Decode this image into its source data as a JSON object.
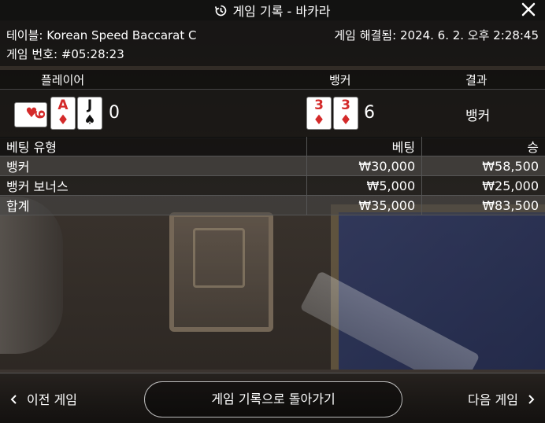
{
  "header": {
    "title": "게임 기록 - 바카라",
    "close_icon": "close-icon",
    "history_icon": "history-icon"
  },
  "meta": {
    "table_label": "테이블:",
    "table_name": "Korean Speed Baccarat C",
    "game_no_label": "게임 번호:",
    "game_no": "#05:28:23",
    "resolved_label": "게임 해결됨:",
    "resolved_time": "2024. 6. 2. 오후 2:28:45"
  },
  "outcome": {
    "player_header": "플레이어",
    "banker_header": "뱅커",
    "result_header": "결과",
    "player_cards": [
      {
        "rank": "9",
        "suit": "♥",
        "color": "#d42a2a",
        "sideways": true
      },
      {
        "rank": "A",
        "suit": "♦",
        "color": "#d42a2a",
        "sideways": false
      },
      {
        "rank": "J",
        "suit": "♠",
        "color": "#111111",
        "sideways": false
      }
    ],
    "player_score": "0",
    "banker_cards": [
      {
        "rank": "3",
        "suit": "♦",
        "color": "#d42a2a",
        "sideways": false
      },
      {
        "rank": "3",
        "suit": "♦",
        "color": "#d42a2a",
        "sideways": false
      }
    ],
    "banker_score": "6",
    "result": "뱅커"
  },
  "bets": {
    "headers": [
      "베팅 유형",
      "베팅",
      "승"
    ],
    "rows": [
      {
        "type": "뱅커",
        "bet": "₩30,000",
        "win": "₩58,500"
      },
      {
        "type": "뱅커 보너스",
        "bet": "₩5,000",
        "win": "₩25,000"
      }
    ],
    "total": {
      "type": "합계",
      "bet": "₩35,000",
      "win": "₩83,500"
    }
  },
  "footer": {
    "prev_label": "이전 게임",
    "back_label": "게임 기록으로 돌아가기",
    "next_label": "다음 게임"
  }
}
